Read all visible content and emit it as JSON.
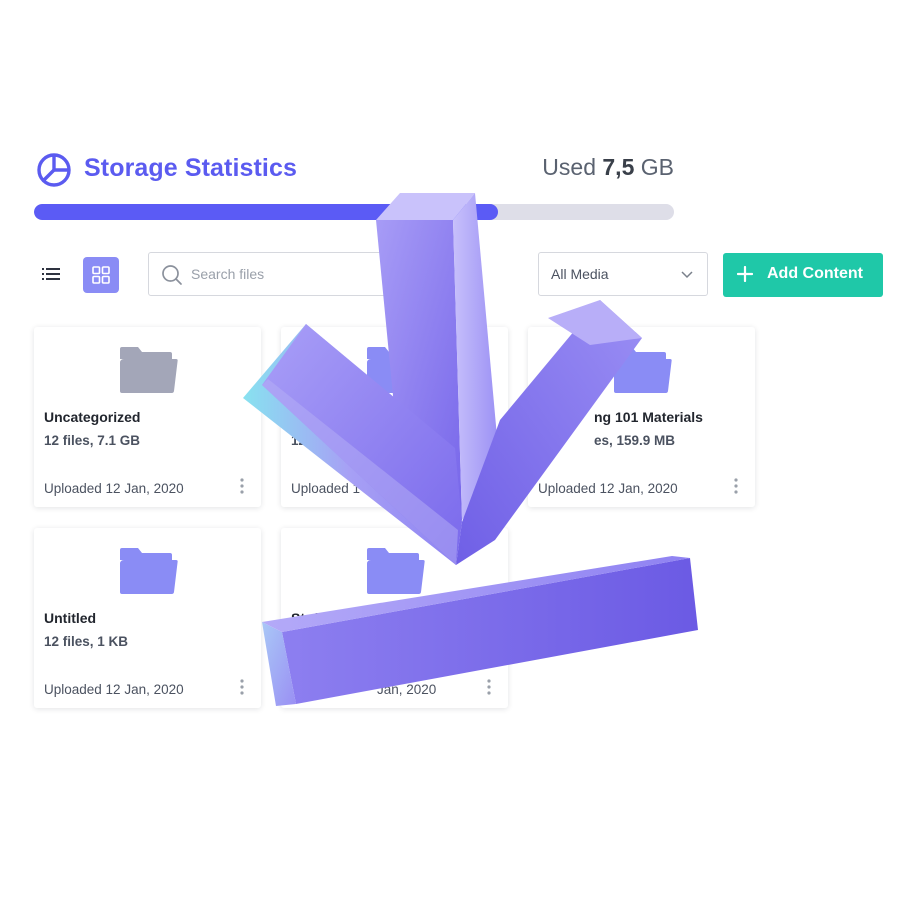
{
  "header": {
    "title": "Storage Statistics",
    "used_prefix": "Used",
    "used_value": "7,5",
    "used_unit": "GB"
  },
  "storage_progress": 0.725,
  "toolbar": {
    "search_placeholder": "Search files",
    "filter_selected": "All Media",
    "add_label": "Add Content"
  },
  "cards": [
    {
      "name": "Uncategorized",
      "meta": "12 files, 7.1 GB",
      "date": "Uploaded 12 Jan, 2020",
      "folder_color": "#a3a6b8"
    },
    {
      "name": "",
      "meta": "12",
      "date": "Uploaded 1",
      "folder_color": "#8a8cf5"
    },
    {
      "name": "ng 101 Materials",
      "meta": "es, 159.9 MB",
      "date": "Uploaded 12 Jan, 2020",
      "folder_color": "#8a8cf5"
    },
    {
      "name": "Untitled",
      "meta": "12 files, 1 KB",
      "date": "Uploaded 12 Jan, 2020",
      "folder_color": "#8a8cf5"
    },
    {
      "name": "Stuff",
      "meta": "",
      "date": "Jan, 2020",
      "folder_color": "#8a8cf5"
    }
  ],
  "colors": {
    "accent": "#5b5bf0",
    "progress": "#5b5bf5",
    "add_button": "#1fc8a8",
    "arrow": "#7b6cf0"
  },
  "icons": {
    "logo": "pie-chart-icon",
    "list_view": "list-icon",
    "grid_view": "grid-icon",
    "search": "search-icon",
    "dropdown": "chevron-down-icon",
    "add": "plus-icon",
    "folder": "folder-icon",
    "more": "more-vertical-icon",
    "overlay": "download-arrow-icon"
  }
}
